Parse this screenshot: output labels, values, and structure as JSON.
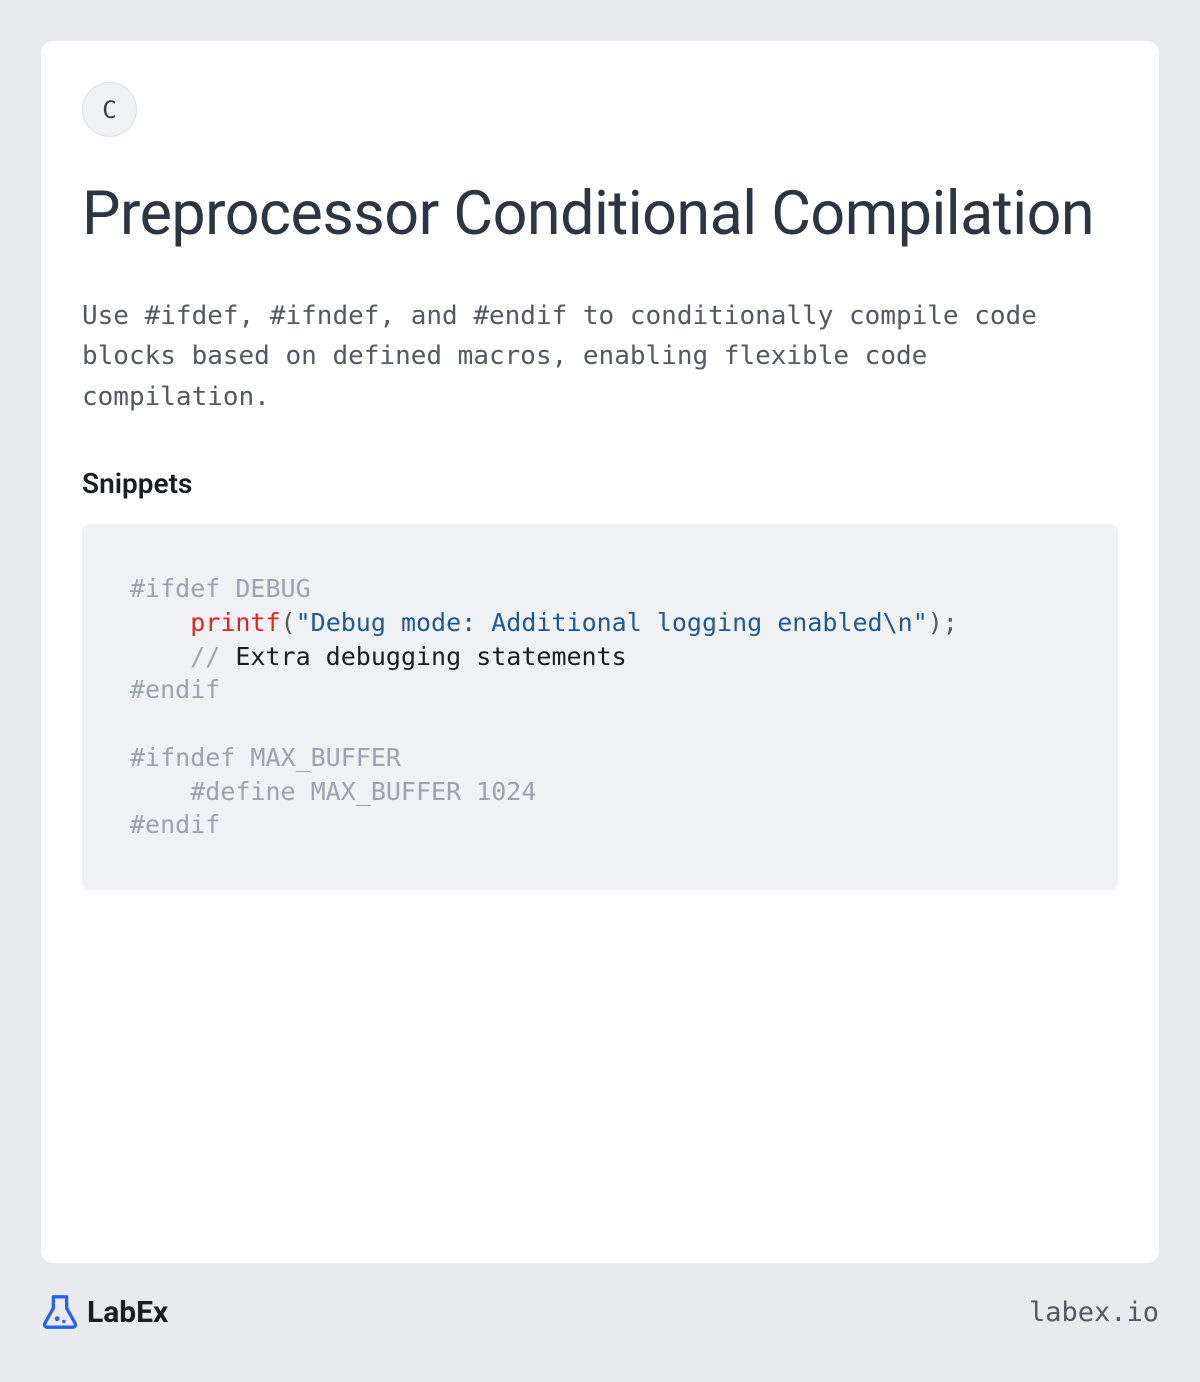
{
  "lang_badge": "C",
  "title": "Preprocessor Conditional Compilation",
  "description": "Use #ifdef, #ifndef, and #endif to conditionally compile code blocks based on defined macros, enabling flexible code compilation.",
  "snippets_heading": "Snippets",
  "code": {
    "line1_directive": "#ifdef",
    "line1_macro": " DEBUG",
    "line2_indent": "    ",
    "line2_func": "printf",
    "line2_open": "(",
    "line2_string": "\"Debug mode: Additional logging enabled\\n\"",
    "line2_close": ");",
    "line3_indent": "    ",
    "line3_comment_prefix": "// ",
    "line3_comment_text": "Extra debugging statements",
    "line4_directive": "#endif",
    "line6_directive": "#ifndef",
    "line6_macro": " MAX_BUFFER",
    "line7_indent": "    ",
    "line7_directive": "#define",
    "line7_rest": " MAX_BUFFER 1024",
    "line8_directive": "#endif"
  },
  "footer": {
    "brand": "LabEx",
    "url": "labex.io"
  }
}
